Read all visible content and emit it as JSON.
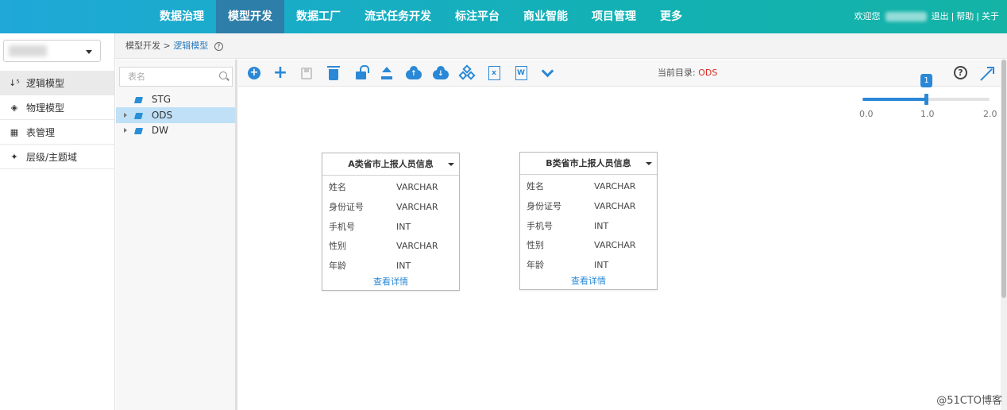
{
  "nav": {
    "items": [
      "数据治理",
      "模型开发",
      "数据工厂",
      "流式任务开发",
      "标注平台",
      "商业智能",
      "项目管理",
      "更多"
    ],
    "active_index": 1
  },
  "topright": {
    "welcome": "欢迎您",
    "logout": "退出",
    "help": "帮助",
    "about": "关于"
  },
  "sidebar": {
    "items": [
      {
        "icon": "sort-icon",
        "label": "逻辑模型"
      },
      {
        "icon": "cube-icon",
        "label": "物理模型"
      },
      {
        "icon": "grid-icon",
        "label": "表管理"
      },
      {
        "icon": "layers-icon",
        "label": "层级/主题域"
      }
    ],
    "active_index": 0
  },
  "breadcrumb": {
    "parent": "模型开发",
    "separator": ">",
    "current": "逻辑模型"
  },
  "tree": {
    "search_placeholder": "表名",
    "nodes": [
      {
        "label": "STG",
        "expandable": false
      },
      {
        "label": "ODS",
        "expandable": true
      },
      {
        "label": "DW",
        "expandable": true
      }
    ],
    "selected_index": 1
  },
  "toolbar": {
    "current_dir_label": "当前目录:",
    "current_dir_value": "ODS",
    "xls_glyph": "x",
    "doc_glyph": "W",
    "help_glyph": "?"
  },
  "zoom": {
    "value": 1.0,
    "min": 0.0,
    "max": 2.0,
    "bubble": "1",
    "ticks": [
      "0.0",
      "1.0",
      "2.0"
    ]
  },
  "cards": [
    {
      "title": "A类省市上报人员信息",
      "fields": [
        {
          "name": "姓名",
          "type": "VARCHAR"
        },
        {
          "name": "身份证号",
          "type": "VARCHAR"
        },
        {
          "name": "手机号",
          "type": "INT"
        },
        {
          "name": "性别",
          "type": "VARCHAR"
        },
        {
          "name": "年龄",
          "type": "INT"
        }
      ],
      "link": "查看详情"
    },
    {
      "title": "B类省市上报人员信息",
      "fields": [
        {
          "name": "姓名",
          "type": "VARCHAR"
        },
        {
          "name": "身份证号",
          "type": "VARCHAR"
        },
        {
          "name": "手机号",
          "type": "INT"
        },
        {
          "name": "性别",
          "type": "VARCHAR"
        },
        {
          "name": "年龄",
          "type": "INT"
        }
      ],
      "link": "查看详情"
    }
  ],
  "watermark": "@51CTO博客",
  "colors": {
    "accent": "#2a88d6",
    "nav_active": "#2d7ea8",
    "current_dir": "#d9281f",
    "tree_selected": "#bfe0f7"
  }
}
